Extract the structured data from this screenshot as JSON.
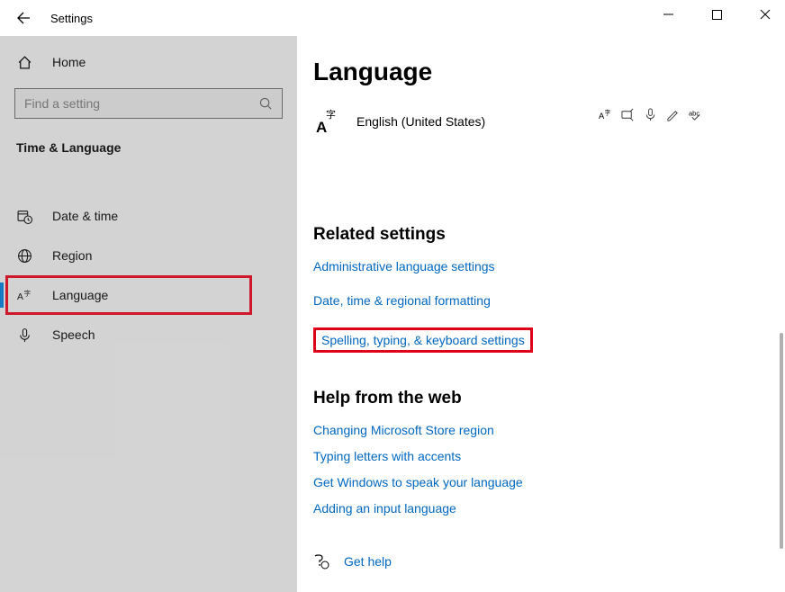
{
  "window": {
    "title": "Settings"
  },
  "sidebar": {
    "home": "Home",
    "search_placeholder": "Find a setting",
    "section": "Time & Language",
    "items": [
      {
        "label": "Date & time"
      },
      {
        "label": "Region"
      },
      {
        "label": "Language"
      },
      {
        "label": "Speech"
      }
    ]
  },
  "main": {
    "title": "Language",
    "current_language": "English (United States)",
    "related": {
      "heading": "Related settings",
      "links": [
        "Administrative language settings",
        "Date, time & regional formatting",
        "Spelling, typing, & keyboard settings"
      ]
    },
    "webhelp": {
      "heading": "Help from the web",
      "links": [
        "Changing Microsoft Store region",
        "Typing letters with accents",
        "Get Windows to speak your language",
        "Adding an input language"
      ]
    },
    "gethelp": "Get help"
  }
}
